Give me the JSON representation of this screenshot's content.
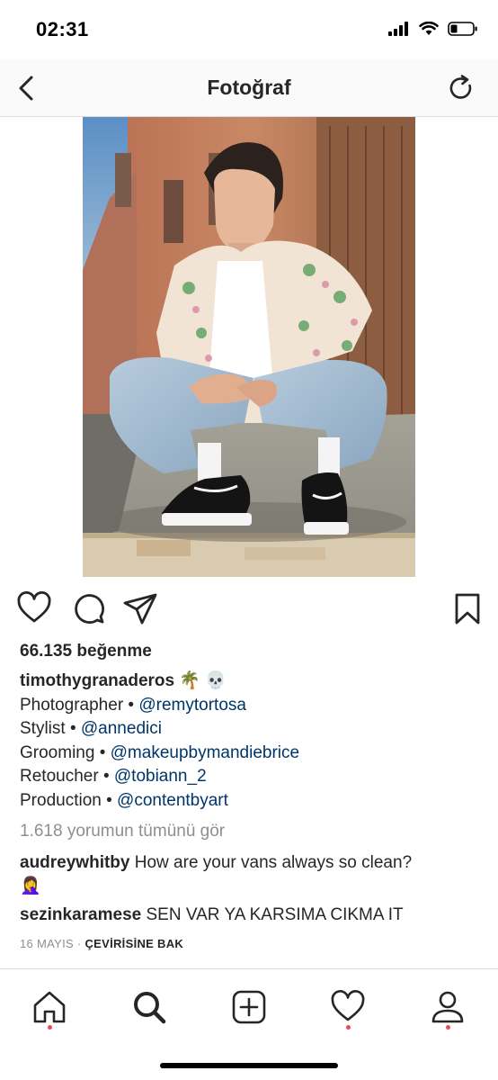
{
  "status": {
    "time": "02:31"
  },
  "header": {
    "title": "Fotoğraf"
  },
  "post": {
    "likes": "66.135 beğenme",
    "author": "timothygranaderos",
    "author_emoji": "🌴 💀",
    "credits": [
      {
        "label": "Photographer •",
        "mention": "@remytortosa"
      },
      {
        "label": "Stylist •",
        "mention": "@annedici"
      },
      {
        "label": "Grooming •",
        "mention": "@makeupbymandiebrice"
      },
      {
        "label": "Retoucher •",
        "mention": "@tobiann_2"
      },
      {
        "label": "Production •",
        "mention": "@contentbyart"
      }
    ],
    "view_all_comments": "1.618 yorumun tümünü gör",
    "comments": [
      {
        "user": "audreywhitby",
        "text": "How are your vans always so clean?",
        "emoji": "🤦‍♀️"
      },
      {
        "user": "sezinkaramese",
        "text": "SEN VAR YA KARSIMA CIKMA IT"
      }
    ],
    "date": "16 MAYIS",
    "separator": "·",
    "translate": "ÇEVİRİSİNE BAK"
  },
  "colors": {
    "mention": "#003569",
    "muted": "#8e8e8e",
    "notification": "#ed4956"
  },
  "icons": {
    "nav": [
      "back-chevron-icon",
      "refresh-icon"
    ],
    "actions": [
      "heart-icon",
      "comment-icon",
      "share-icon",
      "bookmark-icon"
    ],
    "tabs": [
      "home-icon",
      "search-icon",
      "add-icon",
      "activity-heart-icon",
      "profile-icon"
    ]
  }
}
